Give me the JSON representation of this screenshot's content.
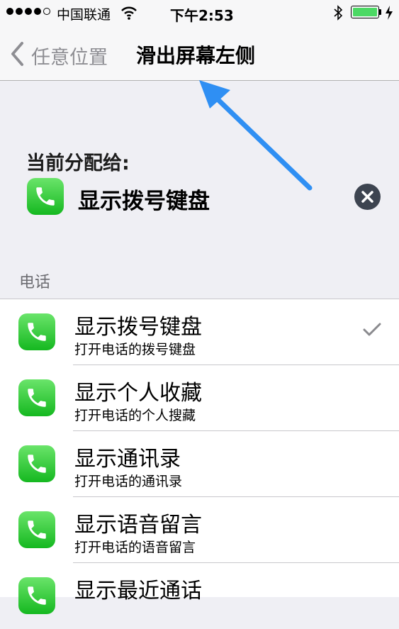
{
  "status_bar": {
    "carrier": "中国联通",
    "time": "下午2:53"
  },
  "nav": {
    "back_label": "任意位置",
    "title": "滑出屏幕左侧"
  },
  "assigned": {
    "header": "当前分配给:",
    "label": "显示拨号键盘"
  },
  "section": {
    "header": "电话"
  },
  "items": [
    {
      "title": "显示拨号键盘",
      "subtitle": "打开电话的拨号键盘",
      "checked": true
    },
    {
      "title": "显示个人收藏",
      "subtitle": "打开电话的个人搜藏",
      "checked": false
    },
    {
      "title": "显示通讯录",
      "subtitle": "打开电话的通讯录",
      "checked": false
    },
    {
      "title": "显示语音留言",
      "subtitle": "打开电话的语音留言",
      "checked": false
    },
    {
      "title": "显示最近通话",
      "subtitle": "",
      "checked": false
    }
  ],
  "colors": {
    "accent_arrow": "#2f8ff3",
    "phone_icon_green": "#2cc334",
    "battery_green": "#4cd964"
  },
  "icons": {
    "back": "chevron-left-icon",
    "phone": "phone-icon",
    "clear": "x-circle-icon",
    "check": "checkmark-icon"
  }
}
